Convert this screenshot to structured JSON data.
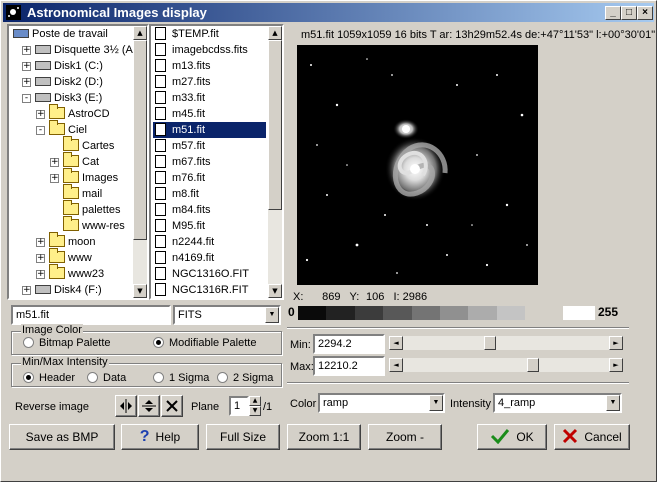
{
  "window": {
    "title": "Astronomical Images display"
  },
  "tree": {
    "items": [
      {
        "label": "Poste de travail",
        "kind": "computer"
      },
      {
        "label": "Disquette 3½ (A:)",
        "kind": "drive"
      },
      {
        "label": "Disk1 (C:)",
        "kind": "drive"
      },
      {
        "label": "Disk2 (D:)",
        "kind": "drive"
      },
      {
        "label": "Disk3 (E:)",
        "kind": "drive"
      },
      {
        "label": "AstroCD",
        "kind": "folder"
      },
      {
        "label": "Ciel",
        "kind": "folder"
      },
      {
        "label": "Cartes",
        "kind": "folder"
      },
      {
        "label": "Cat",
        "kind": "folder"
      },
      {
        "label": "Images",
        "kind": "folder"
      },
      {
        "label": "mail",
        "kind": "folder"
      },
      {
        "label": "palettes",
        "kind": "folder"
      },
      {
        "label": "www-res",
        "kind": "folder"
      },
      {
        "label": "moon",
        "kind": "folder"
      },
      {
        "label": "www",
        "kind": "folder"
      },
      {
        "label": "www23",
        "kind": "folder"
      },
      {
        "label": "Disk4 (F:)",
        "kind": "drive"
      }
    ]
  },
  "files": {
    "items": [
      "$TEMP.fit",
      "imagebcdss.fits",
      "m13.fits",
      "m27.fits",
      "m33.fit",
      "m45.fit",
      "m51.fit",
      "m57.fit",
      "m67.fits",
      "m76.fit",
      "m8.fit",
      "m84.fits",
      "M95.fit",
      "n2244.fit",
      "n4169.fit",
      "NGC1316O.FIT",
      "NGC1316R.FIT"
    ],
    "selected": "m51.fit"
  },
  "filename_field": {
    "value": "m51.fit"
  },
  "filetype_combo": {
    "value": "FITS"
  },
  "image_info": "m51.fit  1059x1059  16 bits T ar: 13h29m52.4s de:+47°11'53\" l:+00°30'01\"",
  "readout": {
    "x_label": "X:",
    "x_value": "869",
    "y_label": "Y:",
    "y_value": "106",
    "i_label": "I:",
    "i_value": "2986"
  },
  "palette_bar": {
    "min_label": "0",
    "max_label": "255"
  },
  "image_color": {
    "title": "Image Color",
    "options": [
      "Bitmap Palette",
      "Modifiable Palette"
    ],
    "selected": "Modifiable Palette"
  },
  "minmax": {
    "title": "Min/Max Intensity",
    "options": [
      "Header",
      "Data",
      "1 Sigma",
      "2 Sigma"
    ],
    "selected": "Header"
  },
  "reverse": {
    "label": "Reverse image"
  },
  "plane": {
    "label": "Plane",
    "value": "1",
    "total": "/1"
  },
  "min": {
    "label": "Min:",
    "value": "2294.2",
    "level": 0.42
  },
  "max": {
    "label": "Max:",
    "value": "12210.2",
    "level": 0.64
  },
  "color": {
    "label": "Color",
    "value": "ramp"
  },
  "intensity": {
    "label": "Intensity",
    "value": "4_ramp"
  },
  "buttons": {
    "save_bmp": "Save as BMP",
    "help": "Help",
    "full_size": "Full Size",
    "zoom_11": "Zoom 1:1",
    "zoom_minus": "Zoom -",
    "ok": "OK",
    "cancel": "Cancel"
  },
  "colors": {
    "title_start": "#0a246a",
    "title_end": "#a6caf0",
    "selection": "#0a246a",
    "ok_check": "#1a8c1a",
    "cancel_x": "#c00000",
    "help_q": "#1c3fb0"
  }
}
